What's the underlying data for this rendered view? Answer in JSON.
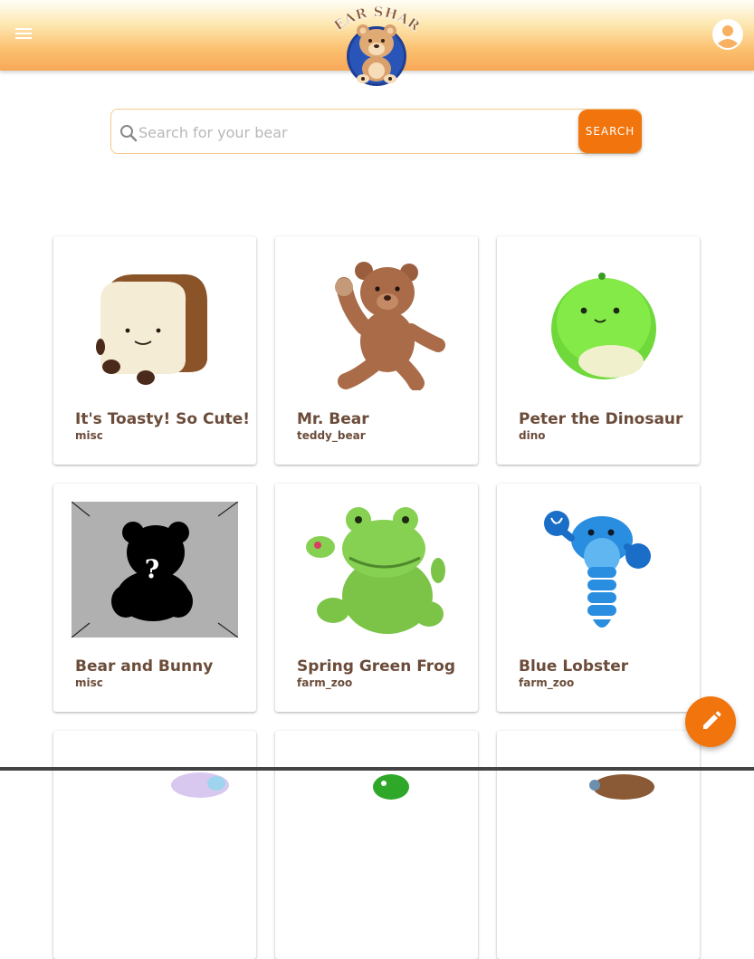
{
  "header": {
    "menu_icon": "menu-icon",
    "logo_text": "BEAR SHARE",
    "account_icon": "account-circle-icon",
    "gradient_colors": [
      "#fffef6",
      "#fde7b0",
      "#fbc06f",
      "#f8a857"
    ]
  },
  "search": {
    "placeholder": "Search for your bear",
    "value": "",
    "button_label": "SEARCH"
  },
  "accent_color": "#f2740c",
  "cards": [
    {
      "title": "It's Toasty! So Cute!",
      "category": "misc",
      "image": "toast-plush"
    },
    {
      "title": "Mr. Bear",
      "category": "teddy_bear",
      "image": "teddy-bear-plush"
    },
    {
      "title": "Peter the Dinosaur",
      "category": "dino",
      "image": "green-dino-plush"
    },
    {
      "title": "Bear and Bunny",
      "category": "misc",
      "image": "placeholder-bear-question"
    },
    {
      "title": "Spring Green Frog",
      "category": "farm_zoo",
      "image": "green-frog-plush"
    },
    {
      "title": "Blue Lobster",
      "category": "farm_zoo",
      "image": "blue-lobster-plush"
    },
    {
      "title": "",
      "category": "",
      "image": "pastel-plush-partial"
    },
    {
      "title": "",
      "category": "",
      "image": "green-plush-partial"
    },
    {
      "title": "",
      "category": "",
      "image": "brown-plush-partial"
    }
  ],
  "fab": {
    "icon": "pencil-icon"
  }
}
